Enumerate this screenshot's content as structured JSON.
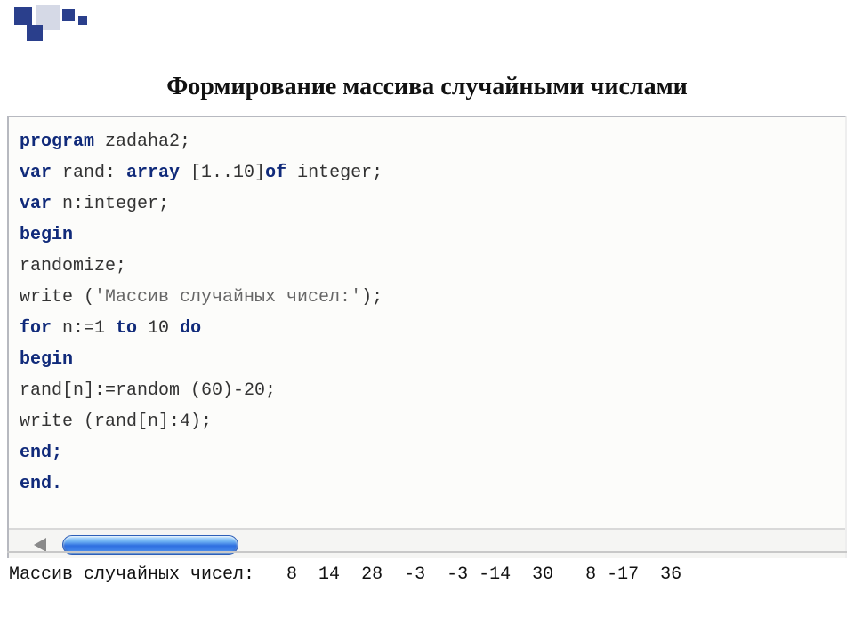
{
  "title": "Формирование массива случайными числами",
  "code": {
    "l1": {
      "a": "program",
      "b": " zadaha2;"
    },
    "l2": {
      "a": "var",
      "b": " rand: ",
      "c": "array",
      "d": " [1..10]",
      "e": "of",
      "f": " integer;"
    },
    "l3": {
      "a": "var",
      "b": " n:integer;"
    },
    "l4": {
      "a": "begin"
    },
    "l5": {
      "a": "randomize;"
    },
    "l6": {
      "a": "write (",
      "b": "'Массив случайных чисел:'",
      "c": ");"
    },
    "l7": {
      "a": "for",
      "b": " n:=1 ",
      "c": "to",
      "d": " 10 ",
      "e": "do"
    },
    "l8": {
      "a": "begin"
    },
    "l9": {
      "a": "rand[n]:=random (60)-20;"
    },
    "l10": {
      "a": "write (rand[n]:4);"
    },
    "l11": {
      "a": "end;"
    },
    "l12": {
      "a": "end."
    }
  },
  "output": "Массив случайных чисел:   8  14  28  -3  -3 -14  30   8 -17  36"
}
